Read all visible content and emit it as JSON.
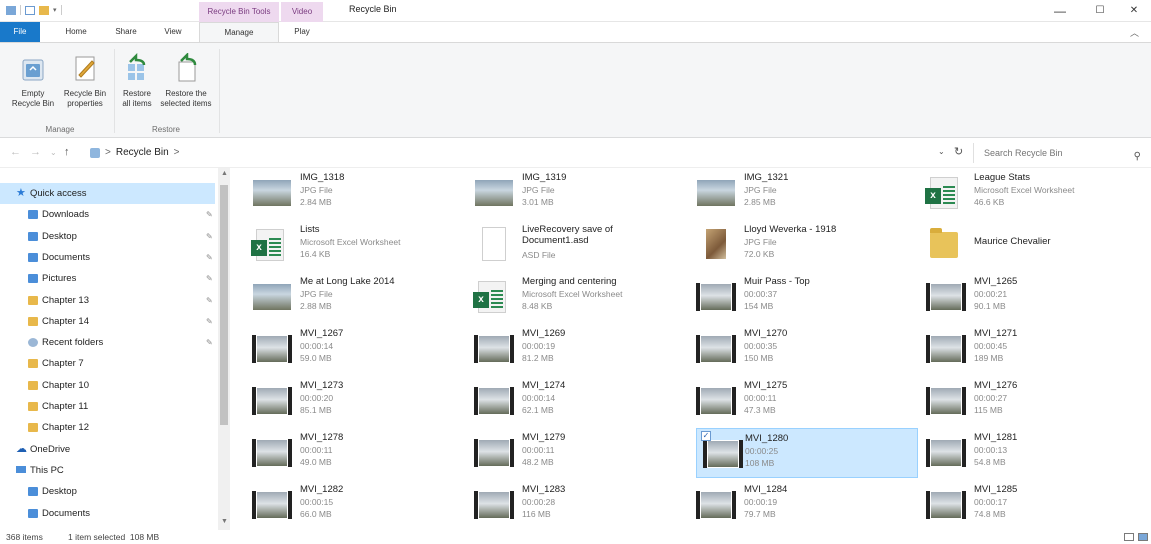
{
  "window": {
    "title": "Recycle Bin",
    "context_tabs": [
      "Recycle Bin Tools",
      "Video Tools"
    ],
    "controls": {
      "minimize": "—",
      "maximize": "☐",
      "close": "✕"
    }
  },
  "ribbon_tabs": [
    "File",
    "Home",
    "Share",
    "View",
    "Manage",
    "Play"
  ],
  "ribbon": {
    "groups": [
      {
        "label": "Manage",
        "buttons": [
          {
            "label": "Empty\nRecycle Bin",
            "icon": "recycle-bin-icon"
          },
          {
            "label": "Recycle Bin\nproperties",
            "icon": "properties-icon"
          }
        ]
      },
      {
        "label": "Restore",
        "buttons": [
          {
            "label": "Restore\nall items",
            "icon": "restore-all-icon"
          },
          {
            "label": "Restore the\nselected items",
            "icon": "restore-selected-icon"
          }
        ]
      }
    ]
  },
  "address": {
    "breadcrumb": [
      "Recycle Bin"
    ],
    "separator": ">",
    "search_placeholder": "Search Recycle Bin"
  },
  "sidebar": {
    "items": [
      {
        "label": "Quick access",
        "icon": "star-icon",
        "selected": true,
        "pinned": false,
        "indent": 0
      },
      {
        "label": "Downloads",
        "icon": "download-folder-icon",
        "pinned": true,
        "indent": 1
      },
      {
        "label": "Desktop",
        "icon": "desktop-folder-icon",
        "pinned": true,
        "indent": 1
      },
      {
        "label": "Documents",
        "icon": "documents-folder-icon",
        "pinned": true,
        "indent": 1
      },
      {
        "label": "Pictures",
        "icon": "pictures-folder-icon",
        "pinned": true,
        "indent": 1
      },
      {
        "label": "Chapter 13",
        "icon": "folder-icon",
        "pinned": true,
        "indent": 1
      },
      {
        "label": "Chapter 14",
        "icon": "folder-icon",
        "pinned": true,
        "indent": 1
      },
      {
        "label": "Recent folders",
        "icon": "recent-folders-icon",
        "pinned": true,
        "indent": 1
      },
      {
        "label": "Chapter 7",
        "icon": "folder-icon",
        "pinned": false,
        "indent": 1
      },
      {
        "label": "Chapter 10",
        "icon": "folder-icon",
        "pinned": false,
        "indent": 1
      },
      {
        "label": "Chapter 11",
        "icon": "folder-icon",
        "pinned": false,
        "indent": 1
      },
      {
        "label": "Chapter 12",
        "icon": "folder-icon",
        "pinned": false,
        "indent": 1
      },
      {
        "label": "OneDrive",
        "icon": "onedrive-icon",
        "pinned": false,
        "indent": 0
      },
      {
        "label": "This PC",
        "icon": "computer-icon",
        "pinned": false,
        "indent": 0
      },
      {
        "label": "Desktop",
        "icon": "desktop-folder-icon",
        "pinned": false,
        "indent": 1
      },
      {
        "label": "Documents",
        "icon": "documents-folder-icon",
        "pinned": false,
        "indent": 1
      }
    ]
  },
  "files": [
    {
      "name": "IMG_1318",
      "line1": "JPG File",
      "line2": "2.84 MB",
      "kind": "photo"
    },
    {
      "name": "IMG_1319",
      "line1": "JPG File",
      "line2": "3.01 MB",
      "kind": "photo"
    },
    {
      "name": "IMG_1321",
      "line1": "JPG File",
      "line2": "2.85 MB",
      "kind": "photo"
    },
    {
      "name": "League Stats",
      "line1": "Microsoft Excel Worksheet",
      "line2": "46.6 KB",
      "kind": "excel"
    },
    {
      "name": "Lists",
      "line1": "Microsoft Excel Worksheet",
      "line2": "16.4 KB",
      "kind": "excel"
    },
    {
      "name": "LiveRecovery save of Document1.asd",
      "line1": "ASD File",
      "line2": "",
      "kind": "doc"
    },
    {
      "name": "Lloyd Weverka - 1918",
      "line1": "JPG File",
      "line2": "72.0 KB",
      "kind": "photo-old"
    },
    {
      "name": "Maurice Chevalier",
      "line1": "",
      "line2": "",
      "kind": "folder"
    },
    {
      "name": "Me at Long Lake 2014",
      "line1": "JPG File",
      "line2": "2.88 MB",
      "kind": "photo"
    },
    {
      "name": "Merging and centering",
      "line1": "Microsoft Excel Worksheet",
      "line2": "8.48 KB",
      "kind": "excel"
    },
    {
      "name": "Muir Pass - Top",
      "line1": "00:00:37",
      "line2": "154 MB",
      "kind": "video"
    },
    {
      "name": "MVI_1265",
      "line1": "00:00:21",
      "line2": "90.1 MB",
      "kind": "video"
    },
    {
      "name": "MVI_1267",
      "line1": "00:00:14",
      "line2": "59.0 MB",
      "kind": "video"
    },
    {
      "name": "MVI_1269",
      "line1": "00:00:19",
      "line2": "81.2 MB",
      "kind": "video"
    },
    {
      "name": "MVI_1270",
      "line1": "00:00:35",
      "line2": "150 MB",
      "kind": "video"
    },
    {
      "name": "MVI_1271",
      "line1": "00:00:45",
      "line2": "189 MB",
      "kind": "video"
    },
    {
      "name": "MVI_1273",
      "line1": "00:00:20",
      "line2": "85.1 MB",
      "kind": "video"
    },
    {
      "name": "MVI_1274",
      "line1": "00:00:14",
      "line2": "62.1 MB",
      "kind": "video"
    },
    {
      "name": "MVI_1275",
      "line1": "00:00:11",
      "line2": "47.3 MB",
      "kind": "video"
    },
    {
      "name": "MVI_1276",
      "line1": "00:00:27",
      "line2": "115 MB",
      "kind": "video"
    },
    {
      "name": "MVI_1278",
      "line1": "00:00:11",
      "line2": "49.0 MB",
      "kind": "video"
    },
    {
      "name": "MVI_1279",
      "line1": "00:00:11",
      "line2": "48.2 MB",
      "kind": "video"
    },
    {
      "name": "MVI_1280",
      "line1": "00:00:25",
      "line2": "108 MB",
      "kind": "video",
      "selected": true
    },
    {
      "name": "MVI_1281",
      "line1": "00:00:13",
      "line2": "54.8 MB",
      "kind": "video"
    },
    {
      "name": "MVI_1282",
      "line1": "00:00:15",
      "line2": "66.0 MB",
      "kind": "video"
    },
    {
      "name": "MVI_1283",
      "line1": "00:00:28",
      "line2": "116 MB",
      "kind": "video"
    },
    {
      "name": "MVI_1284",
      "line1": "00:00:19",
      "line2": "79.7 MB",
      "kind": "video"
    },
    {
      "name": "MVI_1285",
      "line1": "00:00:17",
      "line2": "74.8 MB",
      "kind": "video"
    }
  ],
  "status": {
    "item_count": "368 items",
    "selection": "1 item selected  108 MB"
  },
  "colors": {
    "file_tab": "#1979ca",
    "context_tab": "#eed9ef",
    "selection": "#cce8ff",
    "folder": "#e8b84b",
    "excel": "#1f7244"
  }
}
